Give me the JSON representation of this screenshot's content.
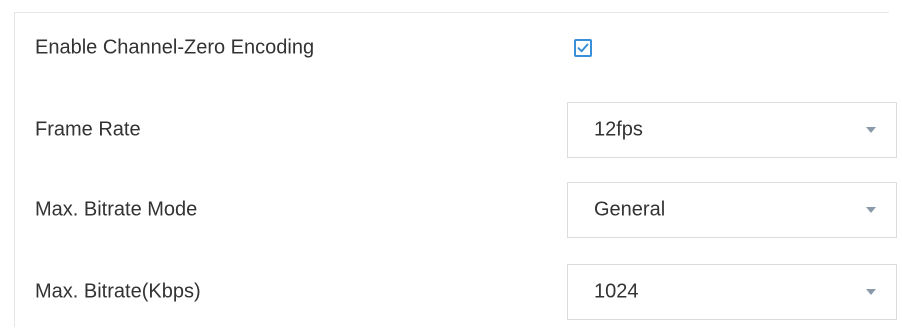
{
  "form": {
    "enable_channel_zero": {
      "label": "Enable Channel-Zero Encoding",
      "checked": true
    },
    "frame_rate": {
      "label": "Frame Rate",
      "value": "12fps"
    },
    "bitrate_mode": {
      "label": "Max. Bitrate Mode",
      "value": "General"
    },
    "max_bitrate": {
      "label": "Max. Bitrate(Kbps)",
      "value": "1024"
    }
  },
  "icons": {
    "checkbox": "checkmark-icon",
    "dropdown": "chevron-down-icon"
  },
  "colors": {
    "accent": "#3b8fd9",
    "text": "#333333",
    "border": "#dcdcdc",
    "arrow": "#8a9aaa"
  }
}
